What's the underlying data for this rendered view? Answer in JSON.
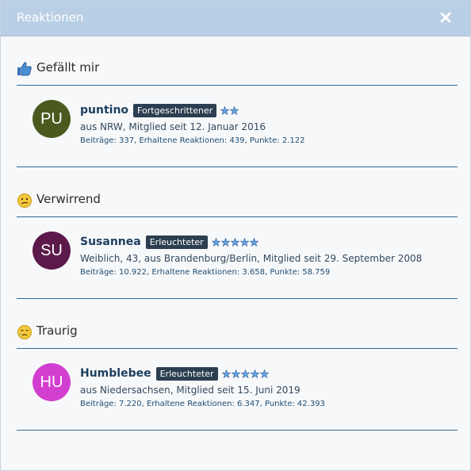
{
  "dialog": {
    "title": "Reaktionen",
    "close_icon": "close-icon"
  },
  "colors": {
    "titlebar": "#b8cfe6",
    "rule": "#2e6a94",
    "rank_badge": "#2c3e50",
    "avatar_pu": "#4a5a1f",
    "avatar_su": "#5b1a4a",
    "avatar_hu": "#d23ecf"
  },
  "sections": [
    {
      "title": "Gefällt mir",
      "icon": "thumbs-up-icon",
      "member": {
        "initials": "PU",
        "username": "puntino",
        "rank": "Fortgeschrittener",
        "stars": 2,
        "meta": "aus NRW, Mitglied seit 12. Januar 2016",
        "stats": "Beiträge: 337, Erhaltene Reaktionen: 439, Punkte: 2.122"
      }
    },
    {
      "title": "Verwirrend",
      "icon": "confused-face-icon",
      "member": {
        "initials": "SU",
        "username": "Susannea",
        "rank": "Erleuchteter",
        "stars": 5,
        "meta": "Weiblich, 43, aus Brandenburg/Berlin, Mitglied seit 29. September 2008",
        "stats": "Beiträge: 10.922, Erhaltene Reaktionen: 3.658, Punkte: 58.759"
      }
    },
    {
      "title": "Traurig",
      "icon": "sad-face-icon",
      "member": {
        "initials": "HU",
        "username": "Humblebee",
        "rank": "Erleuchteter",
        "stars": 5,
        "meta": "aus Niedersachsen, Mitglied seit 15. Juni 2019",
        "stats": "Beiträge: 7.220, Erhaltene Reaktionen: 6.347, Punkte: 42.393"
      }
    }
  ]
}
